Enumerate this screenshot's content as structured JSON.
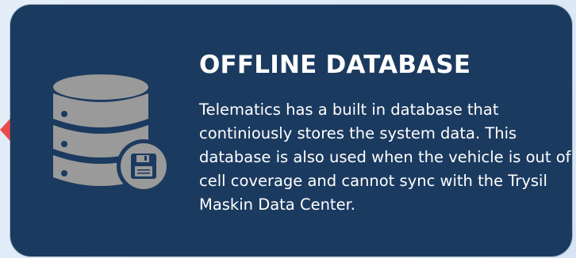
{
  "card": {
    "title": "OFFLINE DATABASE",
    "description": "Telematics has a built in database that continiously stores the system data. This database is also used when the vehicle is out of cell coverage and cannot sync with the Trysil Maskin Data Center.",
    "icon": "database-save-icon"
  },
  "colors": {
    "card_background": "#1b3a5f",
    "icon_gray": "#9a9a9a",
    "accent_red": "#ee4a4e",
    "text": "#ffffff",
    "page_background": "#e4eef9"
  }
}
